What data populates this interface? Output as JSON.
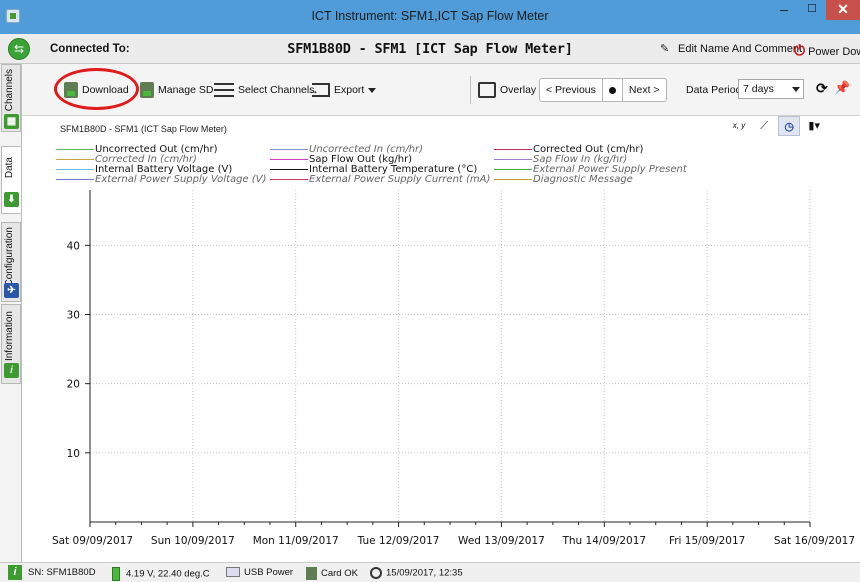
{
  "window": {
    "title": "ICT Instrument: SFM1,ICT Sap Flow Meter",
    "min_glyph": "–",
    "max_glyph": "☐",
    "close_glyph": "✕"
  },
  "connection": {
    "label": "Connected To:",
    "device": "SFM1B80D - SFM1 [ICT Sap Flow Meter]",
    "edit_label": "Edit Name And Comment",
    "power_label": "Power Down"
  },
  "side_tabs": [
    {
      "label": "Channels"
    },
    {
      "label": "Data"
    },
    {
      "label": "Configuration"
    },
    {
      "label": "Information"
    }
  ],
  "toolbar": {
    "download": "Download",
    "manage_sd": "Manage SD",
    "select_channels": "Select Channels",
    "export": "Export",
    "overlay": "Overlay",
    "previous": "< Previous",
    "next": "Next >",
    "period_label": "Data Period:",
    "period_value": "7 days"
  },
  "chart_header": {
    "subtitle": "SFM1B80D - SFM1 (ICT Sap Flow Meter)",
    "xy_label": "x, y"
  },
  "legend": [
    {
      "name": "Uncorrected Out (cm/hr)",
      "color": "#5cb85c",
      "italic": false
    },
    {
      "name": "Uncorrected In (cm/hr)",
      "color": "#7b8fd6",
      "italic": true
    },
    {
      "name": "Corrected Out (cm/hr)",
      "color": "#c0305a",
      "italic": false
    },
    {
      "name": "Corrected In (cm/hr)",
      "color": "#c9a44a",
      "italic": true
    },
    {
      "name": "Sap Flow Out (kg/hr)",
      "color": "#d03fc0",
      "italic": false
    },
    {
      "name": "Sap Flow In (kg/hr)",
      "color": "#9a7cc9",
      "italic": true
    },
    {
      "name": "Internal Battery Voltage (V)",
      "color": "#6fb7e0",
      "italic": false
    },
    {
      "name": "Internal Battery Temperature (°C)",
      "color": "#111111",
      "italic": false
    },
    {
      "name": "External Power Supply Present",
      "color": "#4aa84a",
      "italic": true
    },
    {
      "name": "External Power Supply Voltage (V)",
      "color": "#6a7bd0",
      "italic": true
    },
    {
      "name": "External Power Supply Current (mA)",
      "color": "#c03a5a",
      "italic": true
    },
    {
      "name": "Diagnostic Message",
      "color": "#c39a30",
      "italic": true
    }
  ],
  "chart_data": {
    "type": "line",
    "title": "",
    "xlabel": "",
    "ylabel": "",
    "yticks": [
      10,
      20,
      30,
      40
    ],
    "ylim": [
      0,
      48
    ],
    "x_categories": [
      "Sat 09/09/2017",
      "Sun 10/09/2017",
      "Mon 11/09/2017",
      "Tue 12/09/2017",
      "Wed 13/09/2017",
      "Thu 14/09/2017",
      "Fri 15/09/2017",
      "Sat 16/09/2017"
    ],
    "series": [],
    "grid": true
  },
  "status": {
    "serial": "SN: SFM1B80D",
    "battery": "4.19 V, 22.40 deg.C",
    "power": "USB Power",
    "card": "Card OK",
    "clock": "15/09/2017, 12:35"
  }
}
